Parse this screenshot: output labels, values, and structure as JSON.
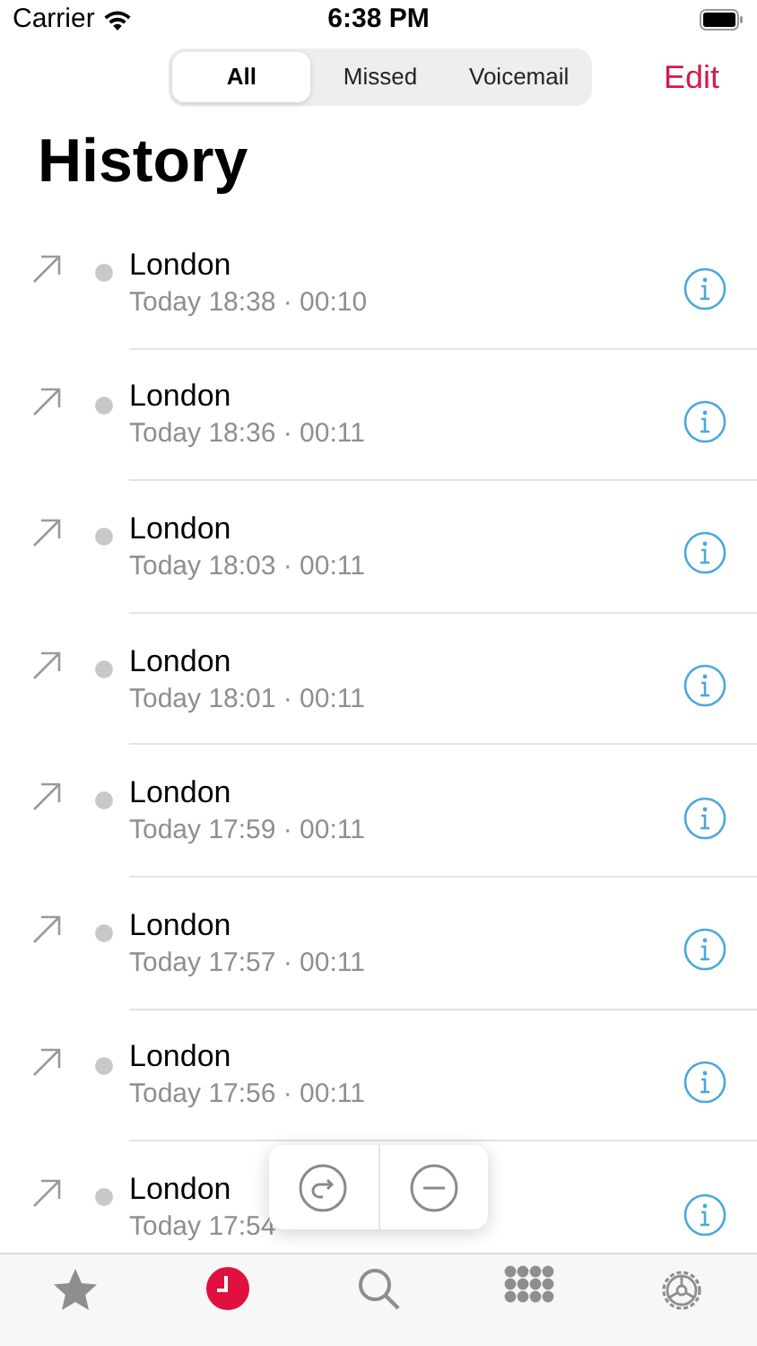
{
  "status_bar": {
    "carrier": "Carrier",
    "time": "6:38 PM"
  },
  "segments": [
    {
      "label": "All",
      "selected": true
    },
    {
      "label": "Missed",
      "selected": false
    },
    {
      "label": "Voicemail",
      "selected": false
    }
  ],
  "edit": "Edit",
  "title": "History",
  "calls": [
    {
      "name": "London",
      "detail": "Today 18:38 · 00:10"
    },
    {
      "name": "London",
      "detail": "Today 18:36 · 00:11"
    },
    {
      "name": "London",
      "detail": "Today 18:03 · 00:11"
    },
    {
      "name": "London",
      "detail": "Today 18:01 · 00:11"
    },
    {
      "name": "London",
      "detail": "Today 17:59 · 00:11"
    },
    {
      "name": "London",
      "detail": "Today 17:57 · 00:11"
    },
    {
      "name": "London",
      "detail": "Today 17:56 · 00:11"
    },
    {
      "name": "London",
      "detail": "Today 17:54"
    }
  ],
  "tab_bar": [
    {
      "selected": false
    },
    {
      "selected": true
    },
    {
      "selected": false
    },
    {
      "selected": false
    },
    {
      "selected": false
    }
  ]
}
